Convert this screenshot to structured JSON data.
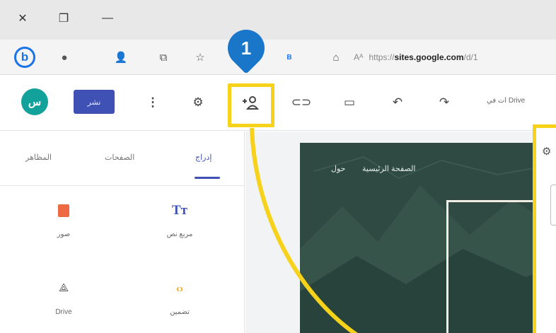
{
  "titlebar": {
    "close_glyph": "✕",
    "restore_glyph": "❐",
    "minimize_glyph": "—"
  },
  "browser": {
    "bing_letter": "b",
    "b_label": "B",
    "url_prefix": "https://",
    "url_host": "sites.google.com",
    "url_path": "/d/1"
  },
  "sites_toolbar": {
    "avatar_initials": "س",
    "publish_label": "نشر",
    "drive_text": "ات في Drive"
  },
  "annotation": {
    "step_number": "1",
    "highlight_color": "#f6d21a",
    "badge_color": "#1976c8"
  },
  "panel": {
    "tabs": [
      {
        "label": "إدراج"
      },
      {
        "label": "الصفحات"
      },
      {
        "label": "المظاهر"
      }
    ],
    "items": [
      {
        "label": "مربع نص",
        "icon": "text-box-icon"
      },
      {
        "label": "صور",
        "icon": "images-icon"
      },
      {
        "label": "تضمين",
        "icon": "embed-icon"
      },
      {
        "label": "Drive",
        "icon": "drive-icon"
      }
    ]
  },
  "canvas": {
    "nav_home": "الصفحة الرئيسية",
    "nav_about": "حول"
  },
  "colors": {
    "accent": "#3f51b5",
    "avatar_bg": "#12a29b",
    "hero_bg": "#2e4a42"
  }
}
